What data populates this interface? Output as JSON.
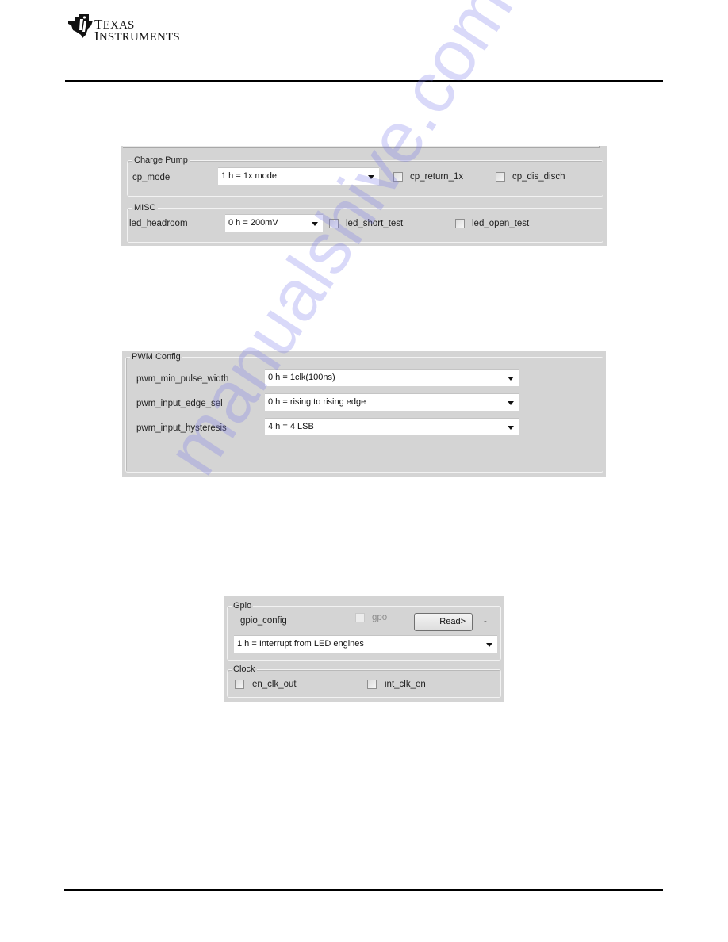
{
  "header": {
    "logo_line1": "Texas",
    "logo_line2": "Instruments"
  },
  "charge_misc_panel": {
    "charge_pump": {
      "legend": "Charge Pump",
      "cp_mode_label": "cp_mode",
      "cp_mode_value": "1 h = 1x mode",
      "cp_return_1x_label": "cp_return_1x",
      "cp_return_1x_checked": false,
      "cp_dis_disch_label": "cp_dis_disch",
      "cp_dis_disch_checked": false
    },
    "misc": {
      "legend": "MISC",
      "led_headroom_label": "led_headroom",
      "led_headroom_value": "0 h = 200mV",
      "led_short_test_label": "led_short_test",
      "led_short_test_checked": false,
      "led_open_test_label": "led_open_test",
      "led_open_test_checked": false
    }
  },
  "pwm_panel": {
    "legend": "PWM Config",
    "rows": [
      {
        "label": "pwm_min_pulse_width",
        "value": "0 h = 1clk(100ns)"
      },
      {
        "label": "pwm_input_edge_sel",
        "value": "0 h = rising to rising edge"
      },
      {
        "label": "pwm_input_hysteresis",
        "value": "4 h = 4 LSB"
      }
    ]
  },
  "gpio_clock_panel": {
    "gpio": {
      "legend": "Gpio",
      "gpio_config_label": "gpio_config",
      "gpo_label": "gpo",
      "gpo_checked": false,
      "read_button": "Read>",
      "read_result": "-",
      "gpio_config_value": "1 h = Interrupt from LED engines"
    },
    "clock": {
      "legend": "Clock",
      "en_clk_out_label": "en_clk_out",
      "en_clk_out_checked": false,
      "int_clk_en_label": "int_clk_en",
      "int_clk_en_checked": false
    }
  },
  "watermark": "manualshive.com"
}
